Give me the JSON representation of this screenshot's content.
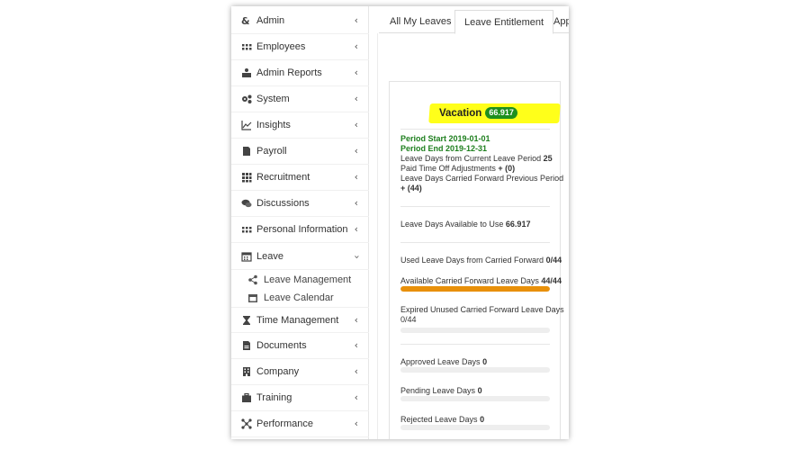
{
  "sidebar": {
    "items": [
      {
        "label": "Admin",
        "icon": "admin-icon"
      },
      {
        "label": "Employees",
        "icon": "employees-icon"
      },
      {
        "label": "Admin Reports",
        "icon": "admin-reports-icon"
      },
      {
        "label": "System",
        "icon": "system-icon"
      },
      {
        "label": "Insights",
        "icon": "insights-icon"
      },
      {
        "label": "Payroll",
        "icon": "payroll-icon"
      },
      {
        "label": "Recruitment",
        "icon": "recruitment-icon"
      },
      {
        "label": "Discussions",
        "icon": "discussions-icon"
      },
      {
        "label": "Personal Information",
        "icon": "personal-information-icon"
      },
      {
        "label": "Leave",
        "icon": "calendar-icon"
      },
      {
        "label": "Time Management",
        "icon": "hourglass-icon"
      },
      {
        "label": "Documents",
        "icon": "documents-icon"
      },
      {
        "label": "Company",
        "icon": "company-icon"
      },
      {
        "label": "Training",
        "icon": "training-icon"
      },
      {
        "label": "Performance",
        "icon": "performance-icon"
      }
    ],
    "leave_subitems": [
      {
        "label": "Leave Management",
        "icon": "share-icon"
      },
      {
        "label": "Leave Calendar",
        "icon": "calendar-icon"
      }
    ]
  },
  "tabs": [
    {
      "label": "All My Leaves"
    },
    {
      "label": "Leave Entitlement"
    },
    {
      "label": "App"
    }
  ],
  "card": {
    "title": "Vacation",
    "badge": "66.917",
    "period_start": "Period Start 2019-01-01",
    "period_end": "Period End 2019-12-31",
    "current_period_label": "Leave Days from Current Leave Period",
    "current_period_value": "25",
    "adjustments_label": "Paid Time Off Adjustments",
    "adjustments_value": "+ (0)",
    "carried_forward_label": "Leave Days Carried Forward Previous Period",
    "carried_forward_value": "+ (44)",
    "available_label": "Leave Days Available to Use",
    "available_value": "66.917",
    "used_cf_label": "Used Leave Days from Carried Forward",
    "used_cf_value": "0/44",
    "avail_cf_label": "Available Carried Forward Leave Days",
    "avail_cf_value": "44/44",
    "avail_cf_progress": 1.0,
    "expired_label": "Expired Unused Carried Forward Leave Days",
    "expired_value": "0/44",
    "expired_progress": 0,
    "approved_label": "Approved Leave Days",
    "approved_value": "0",
    "approved_progress": 0,
    "pending_label": "Pending Leave Days",
    "pending_value": "0",
    "pending_progress": 0,
    "rejected_label": "Rejected Leave Days",
    "rejected_value": "0",
    "rejected_progress": 0
  },
  "colors": {
    "highlight": "#ffff1a",
    "badge": "#1e8f1e",
    "progress": "#e8900a",
    "period_text": "#1e7f1e"
  }
}
